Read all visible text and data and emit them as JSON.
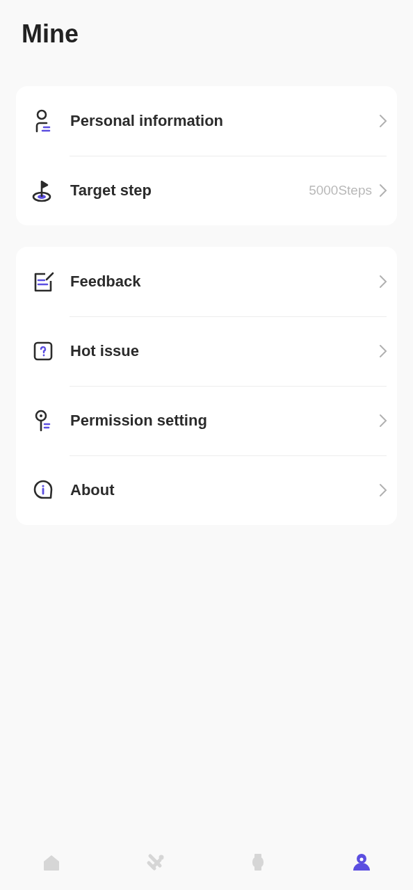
{
  "title": "Mine",
  "groups": [
    {
      "items": [
        {
          "label": "Personal information"
        },
        {
          "label": "Target step",
          "value": "5000Steps"
        }
      ]
    },
    {
      "items": [
        {
          "label": "Feedback"
        },
        {
          "label": "Hot issue"
        },
        {
          "label": "Permission setting"
        },
        {
          "label": "About"
        }
      ]
    }
  ],
  "tabs": [
    {
      "selected": false
    },
    {
      "selected": false
    },
    {
      "selected": false
    },
    {
      "selected": true
    }
  ]
}
